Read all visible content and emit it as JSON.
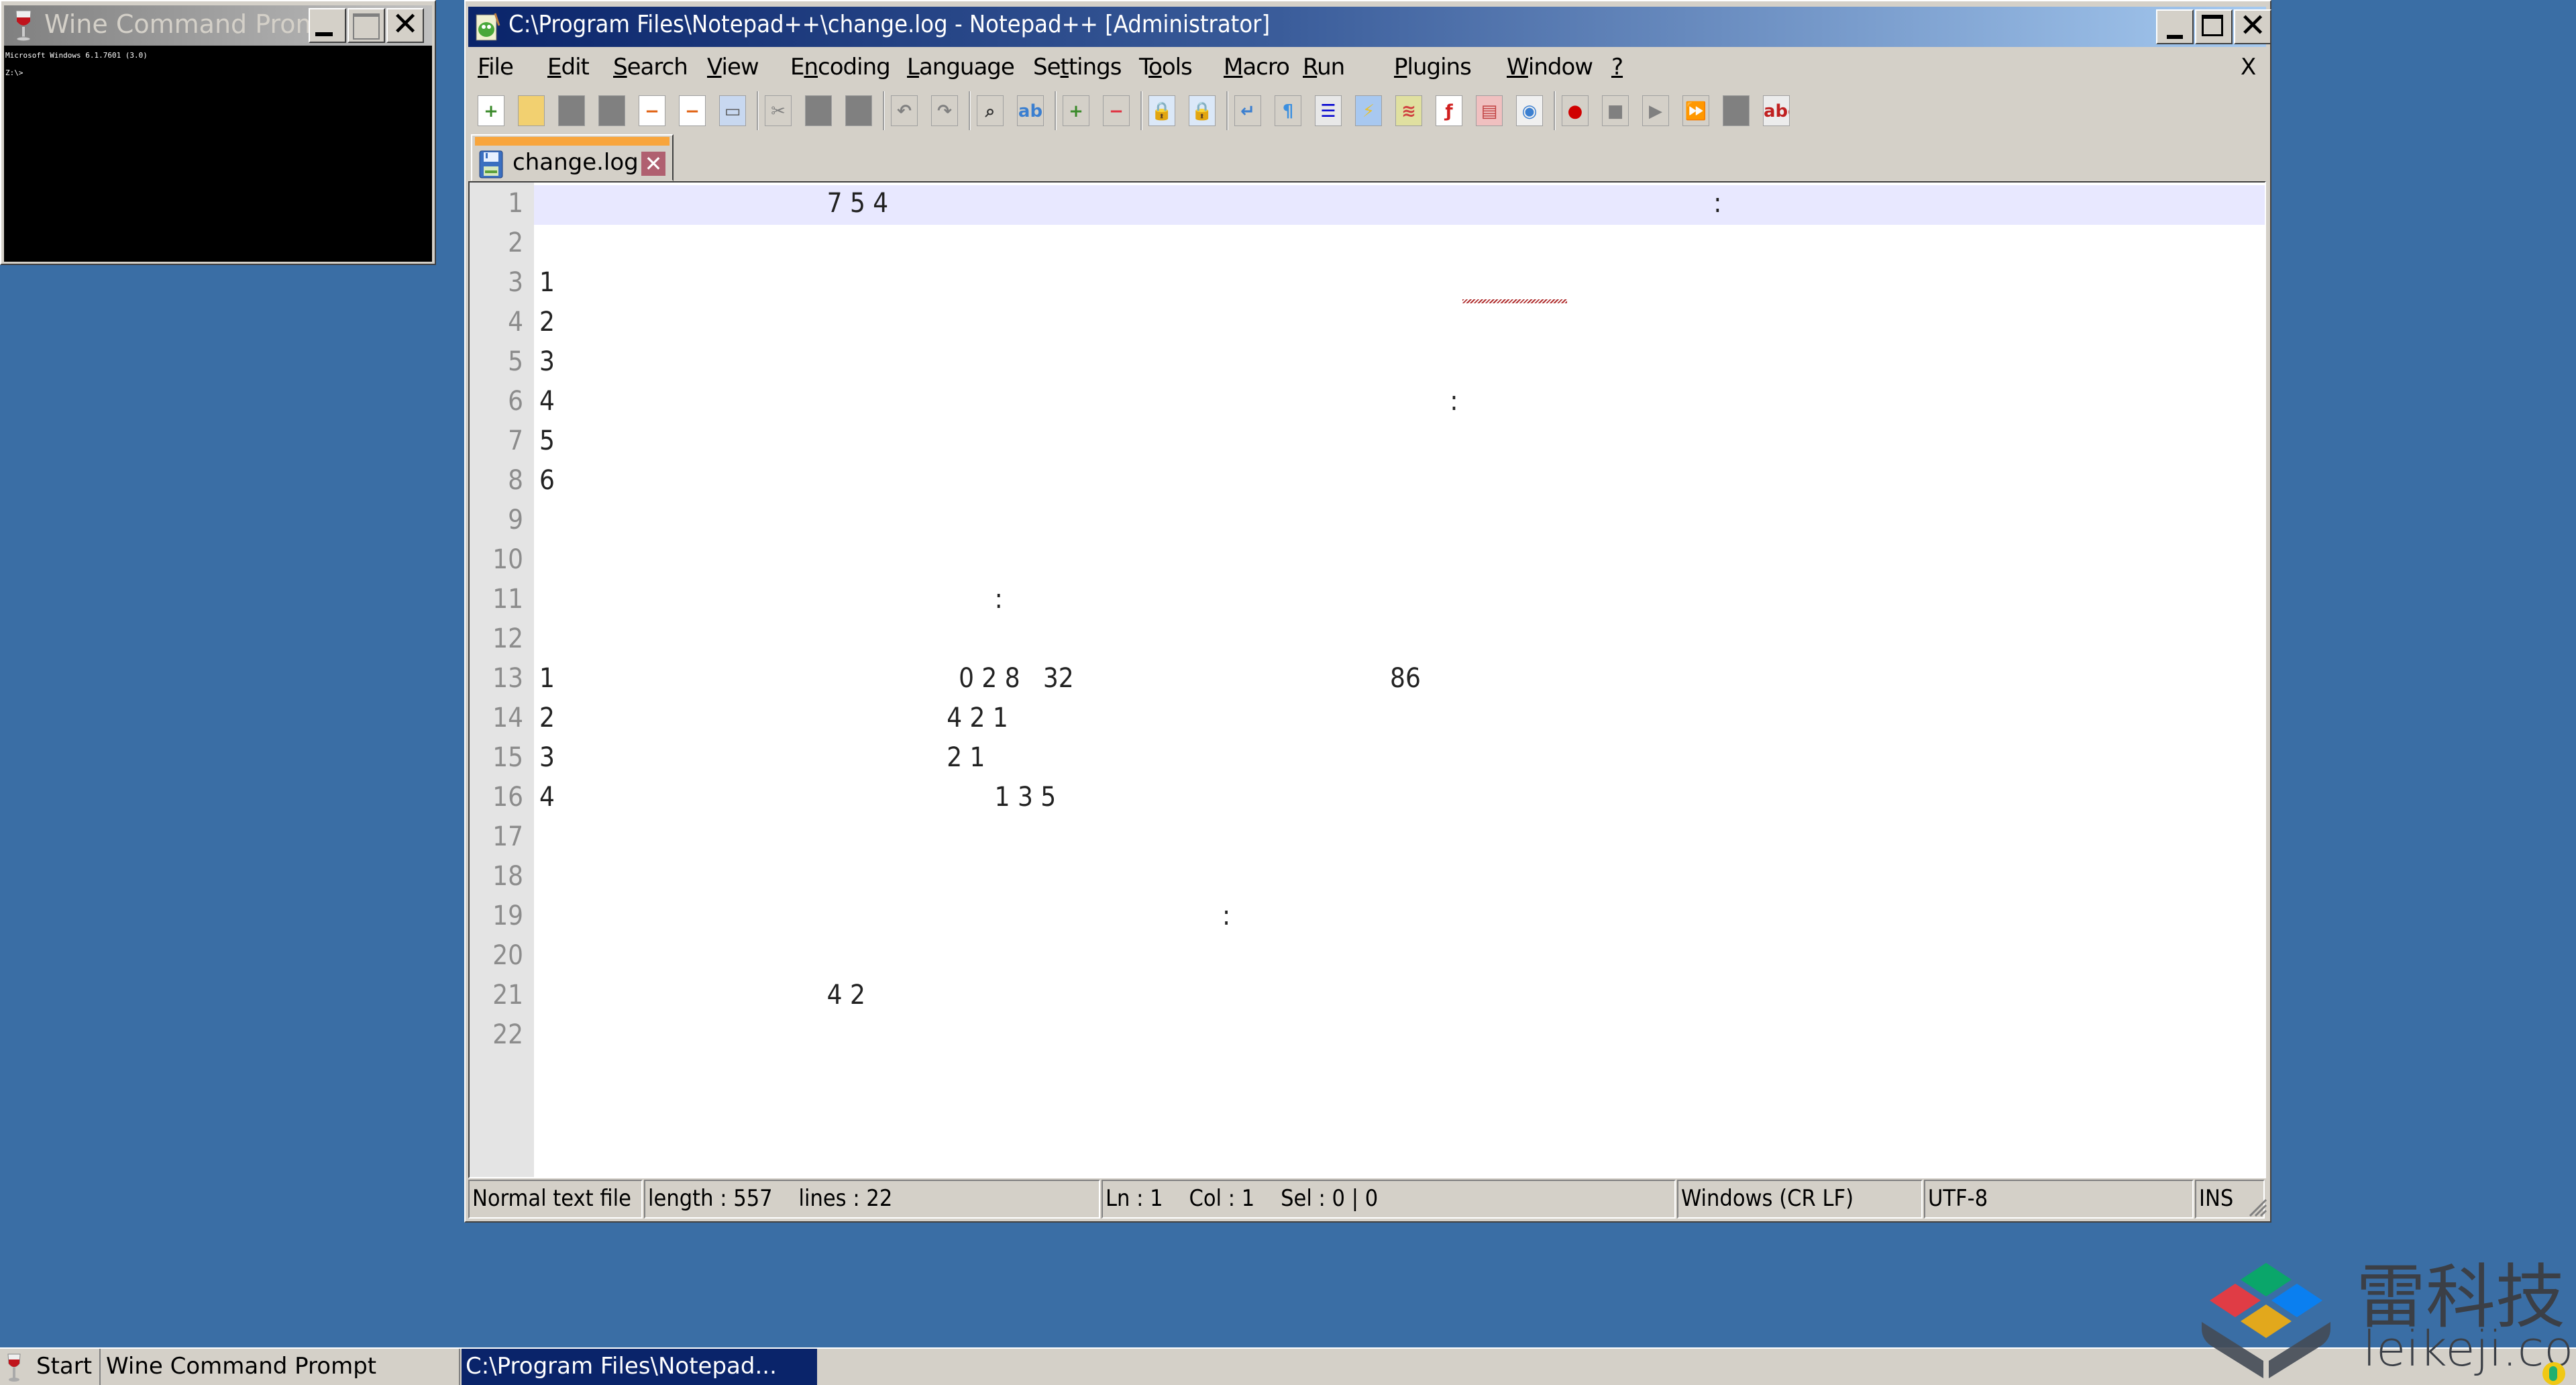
{
  "cmd_window": {
    "title": "Wine Command Prompt",
    "console_lines": [
      "Microsoft Windows 6.1.7601 (3.0)",
      "",
      "Z:\\>"
    ]
  },
  "npp_window": {
    "title": "C:\\Program Files\\Notepad++\\change.log - Notepad++ [Administrator]",
    "menu": [
      {
        "label": "File",
        "accel": 0
      },
      {
        "label": "Edit",
        "accel": 0
      },
      {
        "label": "Search",
        "accel": 0
      },
      {
        "label": "View",
        "accel": 0
      },
      {
        "label": "Encoding",
        "accel": 1
      },
      {
        "label": "Language",
        "accel": 0
      },
      {
        "label": "Settings",
        "accel": 2
      },
      {
        "label": "Tools",
        "accel": 1
      },
      {
        "label": "Macro",
        "accel": 0
      },
      {
        "label": "Run",
        "accel": 0
      },
      {
        "label": "Plugins",
        "accel": 0
      },
      {
        "label": "Window",
        "accel": 0
      },
      {
        "label": "?",
        "accel": 0
      }
    ],
    "menu_close": "X",
    "toolbar": [
      "new-file-icon",
      "open-file-icon",
      "save-icon",
      "save-all-icon",
      "close-icon",
      "close-all-icon",
      "print-icon",
      "sep",
      "cut-icon",
      "copy-icon",
      "paste-icon",
      "sep",
      "undo-icon",
      "redo-icon",
      "sep",
      "find-icon",
      "replace-icon",
      "sep",
      "zoom-in-icon",
      "zoom-out-icon",
      "sep",
      "sync-vertical-icon",
      "sync-horizontal-icon",
      "sep",
      "word-wrap-icon",
      "show-all-chars-icon",
      "indent-guide-icon",
      "language-icon",
      "document-map-icon",
      "function-list-icon",
      "folder-workspace-icon",
      "monitoring-icon",
      "sep",
      "macro-record-icon",
      "macro-stop-icon",
      "macro-play-icon",
      "macro-run-multiple-icon",
      "macro-save-icon",
      "spellcheck-icon"
    ],
    "tab": {
      "label": "change.log"
    },
    "editor": {
      "current_line": 1,
      "lines": [
        {
          "n": "1",
          "tokens": [
            {
              "t": "7 5 4",
              "col": 12
            },
            {
              "t": ":",
              "col": 49
            }
          ]
        },
        {
          "n": "2",
          "tokens": []
        },
        {
          "n": "3",
          "tokens": [
            {
              "t": "1",
              "col": 0
            }
          ],
          "squiggle": true
        },
        {
          "n": "4",
          "tokens": [
            {
              "t": "2",
              "col": 0
            }
          ]
        },
        {
          "n": "5",
          "tokens": [
            {
              "t": "3",
              "col": 0
            }
          ]
        },
        {
          "n": "6",
          "tokens": [
            {
              "t": "4",
              "col": 0
            },
            {
              "t": ":",
              "col": 38
            }
          ]
        },
        {
          "n": "7",
          "tokens": [
            {
              "t": "5",
              "col": 0
            }
          ]
        },
        {
          "n": "8",
          "tokens": [
            {
              "t": "6",
              "col": 0
            }
          ]
        },
        {
          "n": "9",
          "tokens": []
        },
        {
          "n": "10",
          "tokens": []
        },
        {
          "n": "11",
          "tokens": [
            {
              "t": ":",
              "col": 19
            }
          ]
        },
        {
          "n": "12",
          "tokens": []
        },
        {
          "n": "13",
          "tokens": [
            {
              "t": "1",
              "col": 0
            },
            {
              "t": "0 2 8   32",
              "col": 17.5
            },
            {
              "t": "86",
              "col": 35.5
            }
          ]
        },
        {
          "n": "14",
          "tokens": [
            {
              "t": "2",
              "col": 0
            },
            {
              "t": "4 2 1",
              "col": 17
            }
          ]
        },
        {
          "n": "15",
          "tokens": [
            {
              "t": "3",
              "col": 0
            },
            {
              "t": "2 1",
              "col": 17
            }
          ]
        },
        {
          "n": "16",
          "tokens": [
            {
              "t": "4",
              "col": 0
            },
            {
              "t": "1 3 5",
              "col": 19
            }
          ]
        },
        {
          "n": "17",
          "tokens": []
        },
        {
          "n": "18",
          "tokens": []
        },
        {
          "n": "19",
          "tokens": [
            {
              "t": ":",
              "col": 28.5
            }
          ]
        },
        {
          "n": "20",
          "tokens": []
        },
        {
          "n": "21",
          "tokens": [
            {
              "t": "4 2",
              "col": 12
            }
          ]
        },
        {
          "n": "22",
          "tokens": []
        }
      ]
    },
    "status": {
      "file_type": "Normal text file",
      "length_lines": "length : 557    lines : 22",
      "position": "Ln : 1    Col : 1    Sel : 0 | 0",
      "eol": "Windows (CR LF)",
      "encoding": "UTF-8",
      "mode": "INS"
    }
  },
  "taskbar": {
    "start_label": "Start",
    "tasks": [
      {
        "label": "Wine Command Prompt",
        "active": false
      },
      {
        "label": "C:\\Program Files\\Notepad...",
        "active": true
      }
    ]
  },
  "watermark": {
    "brand_cn": "雷科技",
    "url": "leikeji.com"
  },
  "colors": {
    "desktop": "#3a6ea5",
    "active_title_start": "#0a246a",
    "active_title_end": "#a6caf0",
    "current_line": "#e8e8ff",
    "tab_accent": "#f8a53c"
  }
}
